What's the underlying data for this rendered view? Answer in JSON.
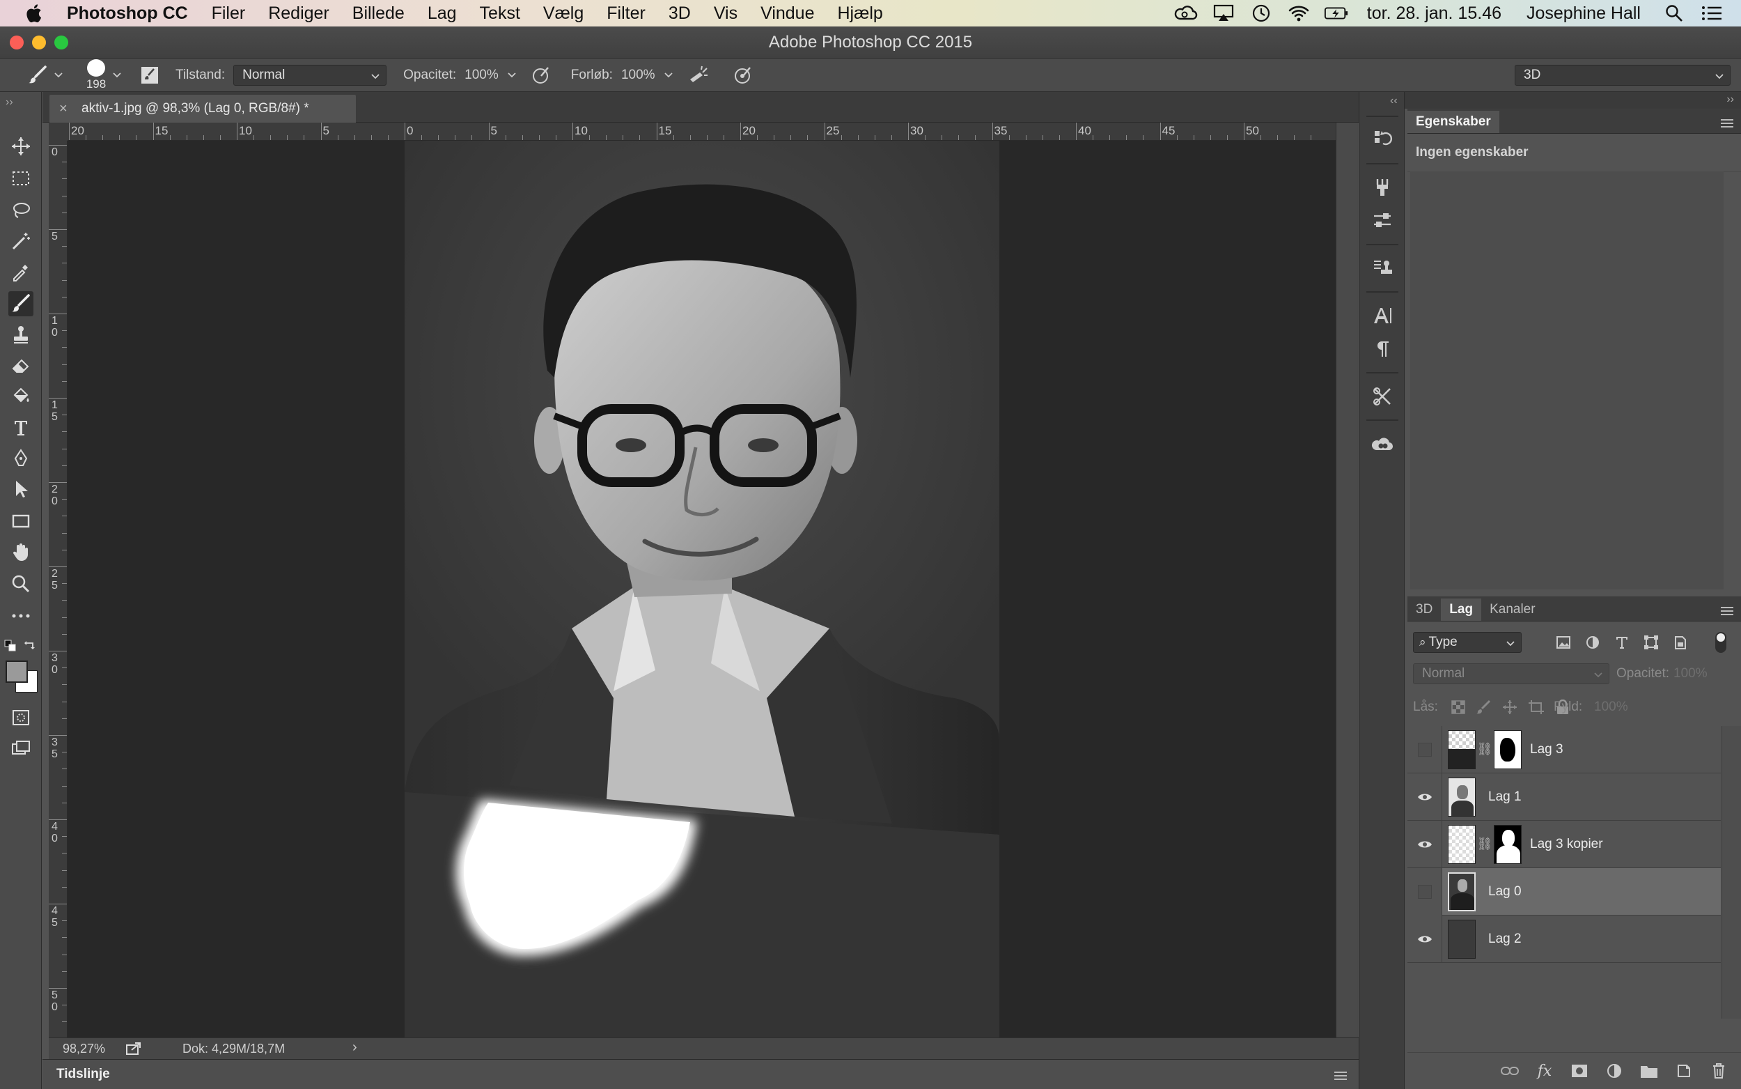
{
  "menubar": {
    "app_name": "Photoshop CC",
    "items": [
      "Filer",
      "Rediger",
      "Billede",
      "Lag",
      "Tekst",
      "Vælg",
      "Filter",
      "3D",
      "Vis",
      "Vindue",
      "Hjælp"
    ],
    "clock": "tor. 28. jan. 15.46",
    "user": "Josephine Hall",
    "status_icons": [
      "creative-cloud-icon",
      "airplay-icon",
      "time-machine-icon",
      "wifi-icon",
      "battery-icon"
    ]
  },
  "window": {
    "title": "Adobe Photoshop CC 2015"
  },
  "options": {
    "brush_size": "198",
    "mode_label": "Tilstand:",
    "mode_value": "Normal",
    "opacity_label": "Opacitet:",
    "opacity_value": "100%",
    "flow_label": "Forløb:",
    "flow_value": "100%",
    "workspace": "3D"
  },
  "document": {
    "tab_label": "aktiv-1.jpg @ 98,3% (Lag 0, RGB/8#) *",
    "zoom": "98,27%",
    "doc_size": "Dok: 4,29M/18,7M"
  },
  "rulers": {
    "top": [
      "20",
      "15",
      "10",
      "5",
      "0",
      "5",
      "10",
      "15",
      "20",
      "25",
      "30",
      "35",
      "40",
      "45",
      "50"
    ],
    "left": [
      [
        "0"
      ],
      [
        "5"
      ],
      [
        "1",
        "0"
      ],
      [
        "1",
        "5"
      ],
      [
        "2",
        "0"
      ],
      [
        "2",
        "5"
      ],
      [
        "3",
        "0"
      ],
      [
        "3",
        "5"
      ],
      [
        "4",
        "0"
      ],
      [
        "4",
        "5"
      ],
      [
        "5",
        "0"
      ]
    ]
  },
  "timeline": {
    "label": "Tidslinje"
  },
  "properties": {
    "tab": "Egenskaber",
    "empty_text": "Ingen egenskaber"
  },
  "layers_panel": {
    "tabs": [
      "3D",
      "Lag",
      "Kanaler"
    ],
    "active_tab": "Lag",
    "filter_kind": "Type",
    "blend_mode": "Normal",
    "opacity_label": "Opacitet:",
    "opacity_value": "100%",
    "lock_label": "Lås:",
    "fill_label": "Fyld:",
    "fill_value": "100%",
    "layers": [
      {
        "name": "Lag 3",
        "visible": false,
        "has_mask": true,
        "selected": false
      },
      {
        "name": "Lag 1",
        "visible": true,
        "has_mask": false,
        "selected": false
      },
      {
        "name": "Lag 3 kopier",
        "visible": true,
        "has_mask": true,
        "selected": false
      },
      {
        "name": "Lag 0",
        "visible": false,
        "has_mask": false,
        "selected": true
      },
      {
        "name": "Lag 2",
        "visible": true,
        "has_mask": false,
        "selected": false
      }
    ]
  }
}
